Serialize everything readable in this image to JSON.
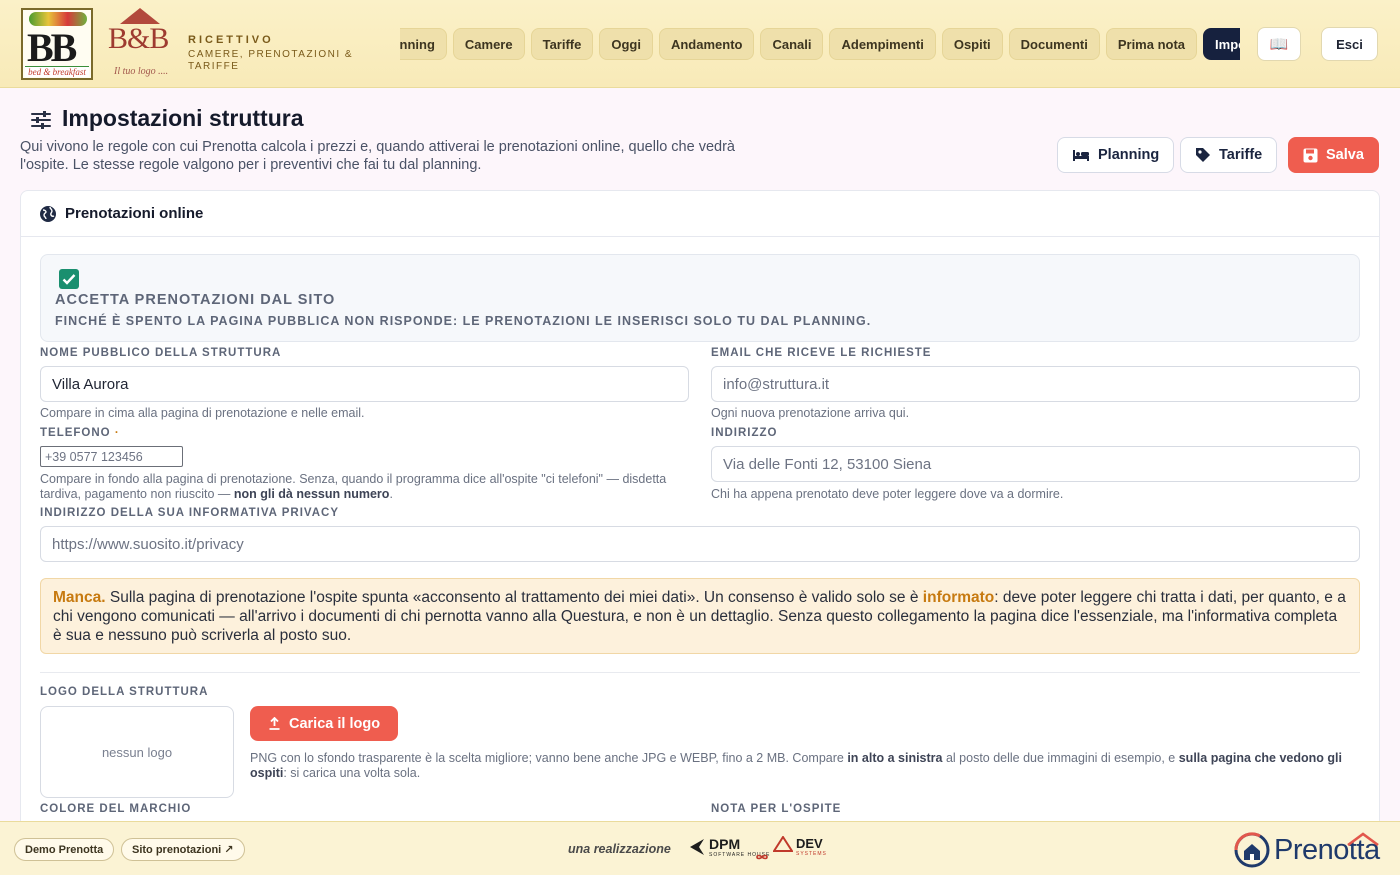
{
  "header": {
    "logo1": {
      "letters": "BB",
      "caption": "bed & breakfast"
    },
    "logo2": {
      "letters": "B&B",
      "caption": "Il tuo logo ...."
    },
    "brand_line1": "RICETTIVO",
    "brand_line2": "CAMERE, PRENOTAZIONI & TARIFFE",
    "nav": [
      {
        "label": "Planning"
      },
      {
        "label": "Camere"
      },
      {
        "label": "Tariffe"
      },
      {
        "label": "Oggi"
      },
      {
        "label": "Andamento"
      },
      {
        "label": "Canali"
      },
      {
        "label": "Adempimenti"
      },
      {
        "label": "Ospiti"
      },
      {
        "label": "Documenti"
      },
      {
        "label": "Prima nota"
      },
      {
        "label": "Impostazioni",
        "active": true
      }
    ],
    "guide_icon": "book-icon",
    "exit_label": "Esci"
  },
  "page": {
    "title": "Impostazioni struttura",
    "description": "Qui vivono le regole con cui Prenotta calcola i prezzi e, quando attiverai le prenotazioni online, quello che vedrà l'ospite. Le stesse regole valgono per i preventivi che fai tu dal planning.",
    "actions": {
      "planning": "Planning",
      "tariffe": "Tariffe",
      "save": "Salva"
    }
  },
  "card": {
    "title": "Prenotazioni online",
    "accept": {
      "checked": true,
      "title": "ACCETTA PRENOTAZIONI DAL SITO",
      "subtitle": "FINCHÉ È SPENTO LA PAGINA PUBBLICA NON RISPONDE: LE PRENOTAZIONI LE INSERISCI SOLO TU DAL PLANNING."
    },
    "fields": {
      "name": {
        "label": "NOME PUBBLICO DELLA STRUTTURA",
        "value": "Villa Aurora",
        "hint": "Compare in cima alla pagina di prenotazione e nelle email."
      },
      "email": {
        "label": "EMAIL CHE RICEVE LE RICHIESTE",
        "placeholder": "info@struttura.it",
        "hint": "Ogni nuova prenotazione arriva qui."
      },
      "phone": {
        "label": "TELEFONO",
        "label_mark": "·",
        "placeholder": "+39 0577 123456",
        "hint_pre": "Compare in fondo alla pagina di prenotazione. Senza, quando il programma dice all'ospite \"ci telefoni\" — disdetta tardiva, pagamento non riuscito — ",
        "hint_bold": "non gli dà nessun numero",
        "hint_post": "."
      },
      "address": {
        "label": "INDIRIZZO",
        "placeholder": "Via delle Fonti 12, 53100 Siena",
        "hint": "Chi ha appena prenotato deve poter leggere dove va a dormire."
      },
      "privacy": {
        "label": "INDIRIZZO DELLA SUA INFORMATIVA PRIVACY",
        "placeholder": "https://www.suosito.it/privacy"
      }
    },
    "warning": {
      "lead": "Manca.",
      "text1": " Sulla pagina di prenotazione l'ospite spunta «acconsento al trattamento dei miei dati». Un consenso è valido solo se è ",
      "highlight": "informato",
      "text2": ": deve poter leggere chi tratta i dati, per quanto, e a chi vengono comunicati — all'arrivo i documenti di chi pernotta vanno alla Questura, e non è un dettaglio. Senza questo collegamento la pagina dice l'essenziale, ma l'informativa completa è sua e nessuno può scriverla al posto suo."
    },
    "logo": {
      "label": "LOGO DELLA STRUTTURA",
      "empty": "nessun logo",
      "upload": "Carica il logo",
      "hint_pre": "PNG con lo sfondo trasparente è la scelta migliore; vanno bene anche JPG e WEBP, fino a 2 MB. Compare ",
      "hint_b1": "in alto a sinistra",
      "hint_mid": " al posto delle due immagini di esempio, e ",
      "hint_b2": "sulla pagina che vedono gli ospiti",
      "hint_post": ": si carica una volta sola."
    },
    "brand_color_label": "COLORE DEL MARCHIO",
    "guest_note_label": "NOTA PER L'OSPITE"
  },
  "footer": {
    "demo": "Demo Prenotta",
    "site": "Sito prenotazioni ↗",
    "credit": "una realizzazione",
    "dpm": "DPM",
    "dpm_sub": "SOFTWARE HOUSE",
    "dev": "DEV",
    "dev_sub": "SYSTEMS",
    "product": "Prenotta"
  },
  "colors": {
    "accent": "#ef5d4f",
    "nav_active": "#16213e",
    "check": "#1a8f6f",
    "warning_bg": "#fdf1dc",
    "highlight": "#c77a10"
  }
}
